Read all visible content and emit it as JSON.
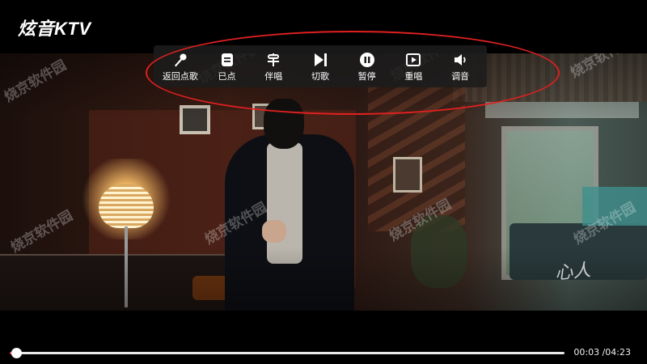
{
  "app": {
    "title": "炫音KTV"
  },
  "toolbar": {
    "items": [
      {
        "label": "返回点歌",
        "icon": "microphone-icon"
      },
      {
        "label": "已点",
        "icon": "playlist-icon"
      },
      {
        "label": "伴唱",
        "icon": "accompany-icon"
      },
      {
        "label": "切歌",
        "icon": "next-track-icon"
      },
      {
        "label": "暂停",
        "icon": "pause-icon"
      },
      {
        "label": "重唱",
        "icon": "replay-icon"
      },
      {
        "label": "调音",
        "icon": "volume-icon"
      }
    ]
  },
  "watermark": {
    "text": "烧京软件园"
  },
  "logo_mark": {
    "text": "心人"
  },
  "playback": {
    "elapsed": "00:03",
    "total": "04:23",
    "time_display": "00:03 /04:23",
    "progress": 0.0114
  },
  "colors": {
    "progress_fill": "#e8324a",
    "highlight": "#e02020",
    "toolbar_bg": "#1c1c1c"
  }
}
